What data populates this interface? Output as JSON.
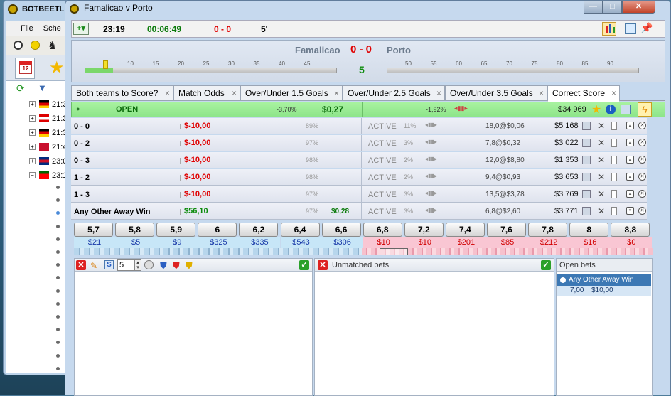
{
  "background_window": {
    "title": "BOTBEETL",
    "menu": [
      "File",
      "Sche"
    ],
    "tab_badge": "12",
    "tree_rows": [
      {
        "time": "21:3",
        "flag": "germany"
      },
      {
        "time": "21:3",
        "flag": "austria"
      },
      {
        "time": "21:3",
        "flag": "germany"
      },
      {
        "time": "21:4",
        "flag": "denmark"
      },
      {
        "time": "23:0",
        "flag": "costa-rica"
      },
      {
        "time": "23:1",
        "flag": "portugal"
      }
    ],
    "child_rows": 16
  },
  "window": {
    "title": "Famalicao v Porto",
    "min": "—",
    "max": "□",
    "close": "✕"
  },
  "toolbar": {
    "clock": "23:19",
    "countdown": "00:06:49",
    "score": "0 - 0",
    "minute": "5'"
  },
  "scoreboard": {
    "home": "Famalicao",
    "away": "Porto",
    "score": "0 - 0",
    "minute": "5",
    "first_half_ticks": [
      "10",
      "15",
      "20",
      "25",
      "30",
      "35",
      "40",
      "45"
    ],
    "second_half_ticks": [
      "50",
      "55",
      "60",
      "65",
      "70",
      "75",
      "80",
      "85",
      "90"
    ],
    "first_half_progress": 0.11
  },
  "tabs": [
    {
      "label": "Both teams to Score?",
      "close": "×"
    },
    {
      "label": "Match Odds",
      "close": "×"
    },
    {
      "label": "Over/Under 1.5 Goals",
      "close": "×"
    },
    {
      "label": "Over/Under 2.5 Goals",
      "close": "×"
    },
    {
      "label": "Over/Under 3.5 Goals",
      "close": "×"
    },
    {
      "label": "Correct Score",
      "close": "×",
      "active": true
    }
  ],
  "market": {
    "status": "OPEN",
    "back_pct": "-3,70%",
    "pnl": "$0,27",
    "lay_pct": "-1,92%",
    "matched": "$34 969"
  },
  "selections": [
    {
      "name": "0 - 0",
      "pl": "$-10,00",
      "pl_color": "#e00000",
      "pct": "89%",
      "status": "ACTIVE",
      "pct2": "11%",
      "vol": "18,0@$0,06",
      "matched": "$5 168",
      "pnl": ""
    },
    {
      "name": "0 - 2",
      "pl": "$-10,00",
      "pl_color": "#e00000",
      "pct": "97%",
      "status": "ACTIVE",
      "pct2": "3%",
      "vol": "7,8@$0,32",
      "matched": "$3 022",
      "pnl": ""
    },
    {
      "name": "0 - 3",
      "pl": "$-10,00",
      "pl_color": "#e00000",
      "pct": "98%",
      "status": "ACTIVE",
      "pct2": "2%",
      "vol": "12,0@$8,80",
      "matched": "$1 353",
      "pnl": ""
    },
    {
      "name": "1 - 2",
      "pl": "$-10,00",
      "pl_color": "#e00000",
      "pct": "98%",
      "status": "ACTIVE",
      "pct2": "2%",
      "vol": "9,4@$0,93",
      "matched": "$3 653",
      "pnl": ""
    },
    {
      "name": "1 - 3",
      "pl": "$-10,00",
      "pl_color": "#e00000",
      "pct": "97%",
      "status": "ACTIVE",
      "pct2": "3%",
      "vol": "13,5@$3,78",
      "matched": "$3 769",
      "pnl": ""
    },
    {
      "name": "Any Other Away Win",
      "pl": "$56,10",
      "pl_color": "#0a8a0a",
      "pct": "97%",
      "status": "ACTIVE",
      "pct2": "3%",
      "vol": "6,8@$2,60",
      "matched": "$3 771",
      "pnl": "$0,28"
    }
  ],
  "ladder": {
    "prices": [
      "5,7",
      "5,8",
      "5,9",
      "6",
      "6,2",
      "6,4",
      "6,6",
      "6,8",
      "7,2",
      "7,4",
      "7,6",
      "7,8",
      "8",
      "8,8"
    ],
    "amounts": [
      "$21",
      "$5",
      "$9",
      "$325",
      "$335",
      "$543",
      "$306",
      "$10",
      "$10",
      "$201",
      "$85",
      "$212",
      "$16",
      "$0"
    ],
    "back_count": 7
  },
  "bet_panel": {
    "stake_value": "5",
    "unmatched_label": "Unmatched bets",
    "open_label": "Open bets",
    "open_bet_name": "Any Other Away Win",
    "open_bet_odds": "7,00",
    "open_bet_stake": "$10,00"
  },
  "colors": {
    "open_bar": "#8ee58a",
    "loss": "#e00000",
    "profit": "#0a8a0a",
    "back": "#c7e6f7",
    "lay": "#f9c6d3",
    "selected_row": "#3c78b4"
  }
}
